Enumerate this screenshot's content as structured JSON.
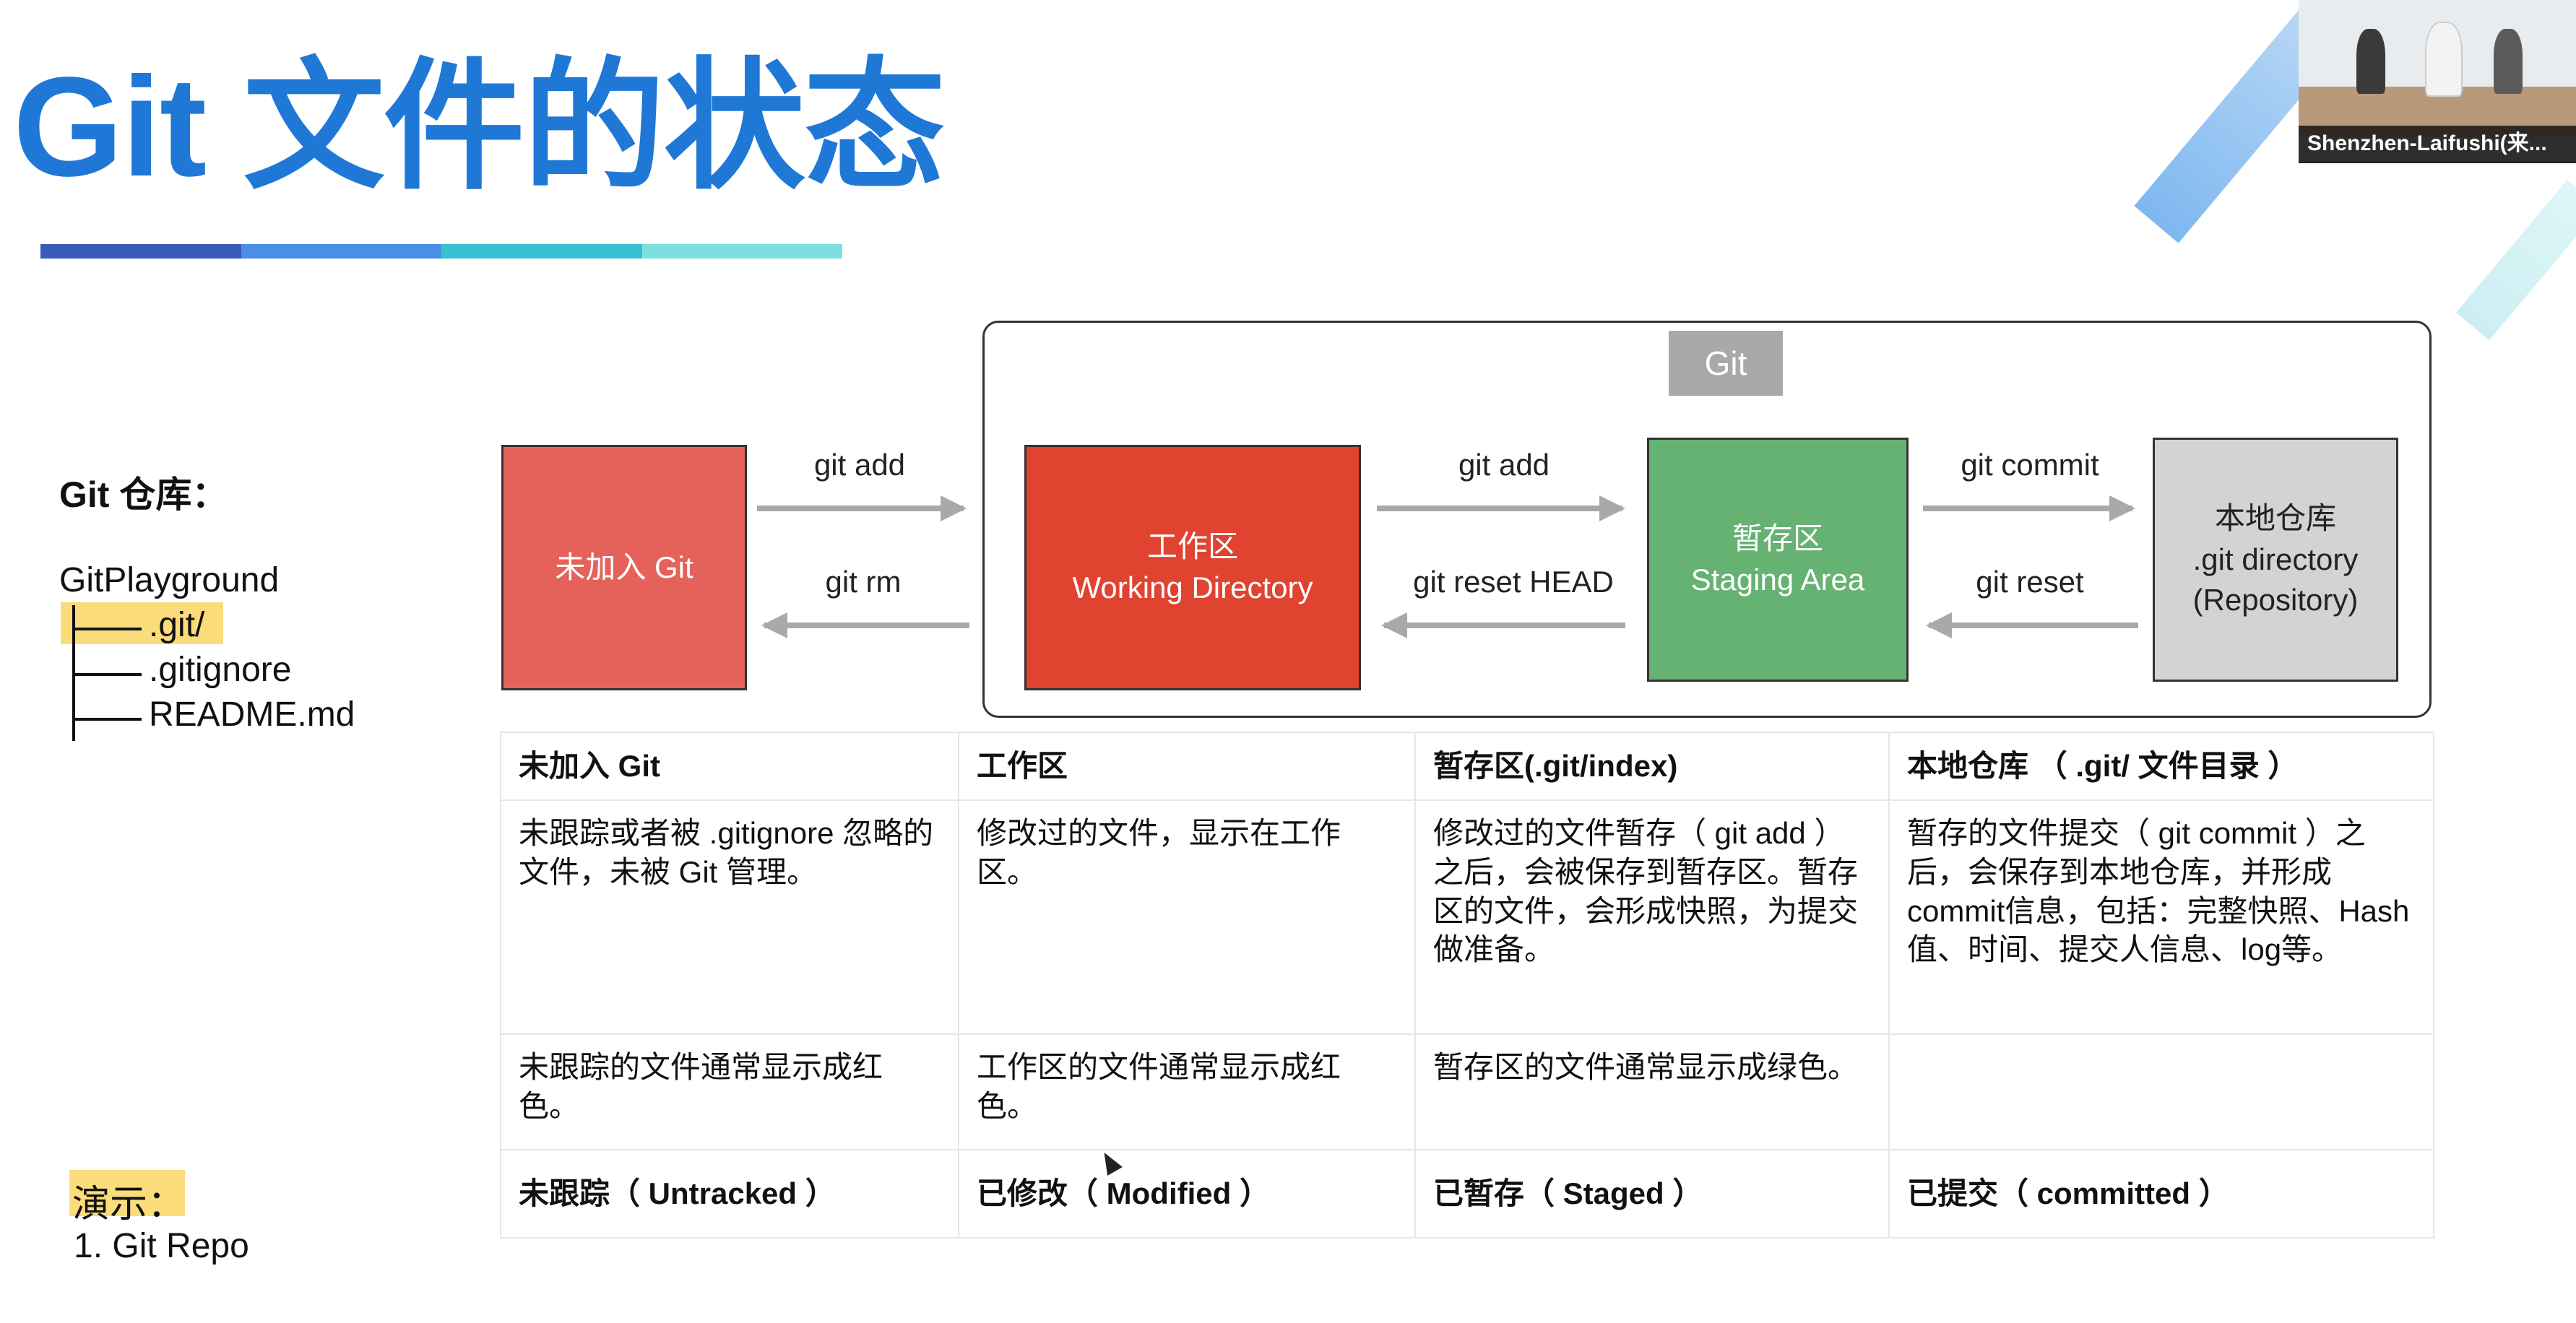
{
  "slide": {
    "title": "Git 文件的状态",
    "title_bar_colors": [
      "#3a5bb5",
      "#4a8fe6",
      "#39c0d2",
      "#7fdede"
    ]
  },
  "video": {
    "caption": "Shenzhen-Laifushi(来..."
  },
  "repo": {
    "label": "Git 仓库：",
    "name": "GitPlayground",
    "items": [
      ".git/",
      ".gitignore",
      "README.md"
    ],
    "highlight_color": "#fbdc7a"
  },
  "demo": {
    "label": "演示：",
    "item": "1. Git Repo"
  },
  "diagram": {
    "frame_label": "Git",
    "boxes": {
      "untracked": [
        "未加入 Git"
      ],
      "working": [
        "工作区",
        "Working Directory"
      ],
      "staging": [
        "暂存区",
        "Staging Area"
      ],
      "repo": [
        "本地仓库",
        ".git directory",
        "(Repository)"
      ]
    },
    "arrows": {
      "a1_top": "git add",
      "a1_bottom": "git rm",
      "a2_top": "git add",
      "a2_bottom": "git reset HEAD",
      "a3_top": "git commit",
      "a3_bottom": "git reset"
    },
    "colors": {
      "untracked": "#e5625a",
      "working": "#e14331",
      "staging": "#66b273",
      "repo": "#d3d3d3",
      "arrow": "#a9a9a9"
    }
  },
  "table": {
    "headers": [
      "未加入 Git",
      "工作区",
      "暂存区(.git/index)",
      "本地仓库 （ .git/ 文件目录 ）"
    ],
    "descriptions": [
      "未跟踪或者被 .gitignore 忽略的文件，未被 Git 管理。",
      "修改过的文件，显示在工作区。",
      "修改过的文件暂存（ git add ）之后，会被保存到暂存区。暂存区的文件，会形成快照，为提交做准备。",
      "暂存的文件提交（ git commit ）之后，会保存到本地仓库，并形成commit信息，包括：完整快照、Hash值、时间、提交人信息、log等。"
    ],
    "colors": [
      "未跟踪的文件通常显示成红色。",
      "工作区的文件通常显示成红色。",
      "暂存区的文件通常显示成绿色。",
      ""
    ],
    "names": [
      "未跟踪（ Untracked ）",
      "已修改（ Modified ）",
      "已暂存（ Staged ）",
      "已提交（ committed ）"
    ]
  }
}
